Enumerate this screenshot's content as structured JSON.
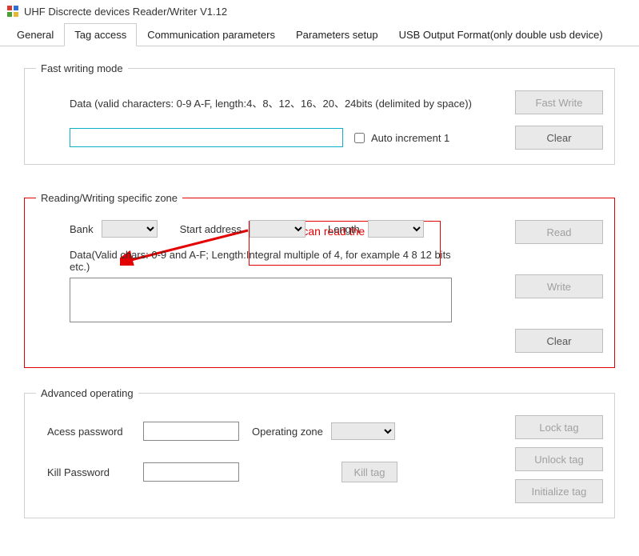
{
  "window": {
    "title": "UHF Discrecte devices Reader/Writer V1.12"
  },
  "tabs": {
    "items": [
      "General",
      "Tag access",
      "Communication parameters",
      "Parameters setup",
      "USB Output Format(only double usb device)"
    ],
    "active_index": 1
  },
  "fast_writing": {
    "legend": "Fast writing mode",
    "data_label": "Data (valid characters: 0-9 A-F, length:4、8、12、16、20、24bits (delimited by space))",
    "auto_increment_label": "Auto increment 1",
    "fast_write_btn": "Fast Write",
    "clear_btn": "Clear",
    "input_value": ""
  },
  "callout": {
    "text": "This part can read the data of tag."
  },
  "rw_zone": {
    "legend": "Reading/Writing specific zone",
    "bank_label": "Bank",
    "start_addr_label": "Start address",
    "length_label": "Length",
    "data_hint": "Data(Valid chars: 0-9 and A-F; Length:Integral multiple of 4, for example 4 8 12 bits etc.)",
    "read_btn": "Read",
    "write_btn": "Write",
    "clear_btn": "Clear",
    "textarea_value": ""
  },
  "advanced": {
    "legend": "Advanced operating",
    "access_pw_label": "Acess password",
    "operating_zone_label": "Operating zone",
    "kill_pw_label": "Kill Password",
    "kill_tag_btn": "Kill tag",
    "lock_tag_btn": "Lock tag",
    "unlock_tag_btn": "Unlock tag",
    "init_tag_btn": "Initialize tag",
    "access_pw_value": "",
    "kill_pw_value": ""
  }
}
